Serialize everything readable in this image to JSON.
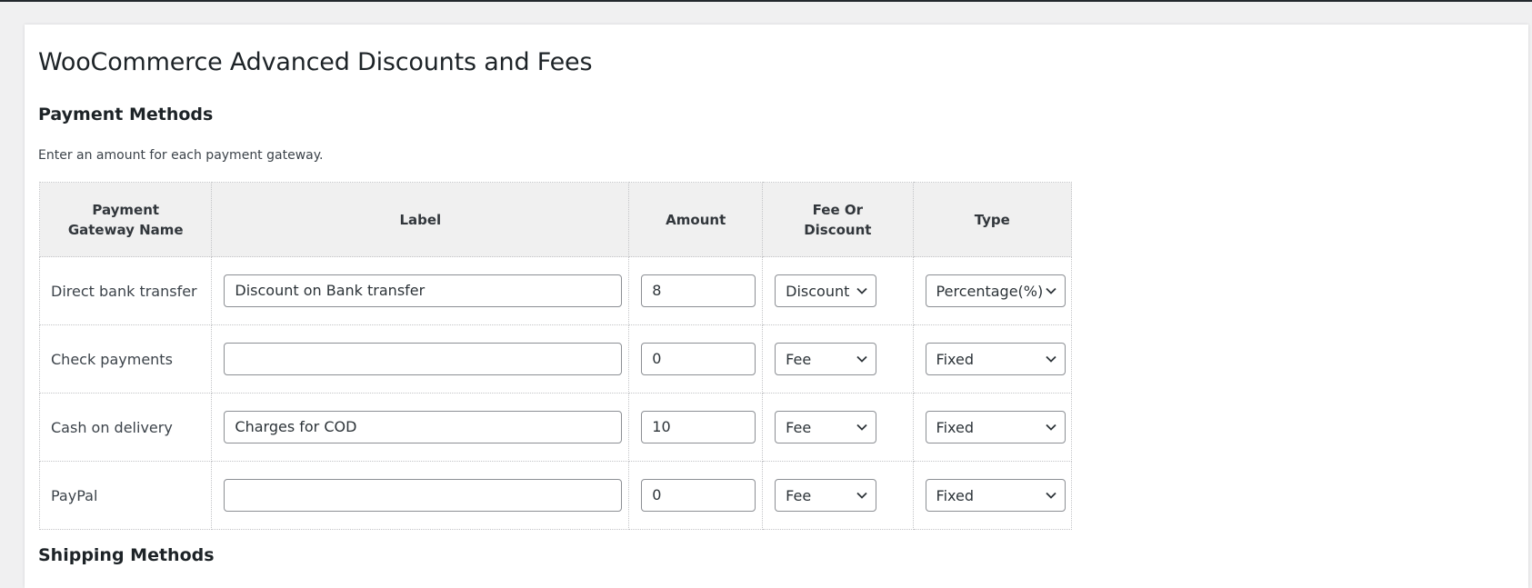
{
  "page": {
    "title": "WooCommerce Advanced Discounts and Fees"
  },
  "payment_section": {
    "title": "Payment Methods",
    "description": "Enter an amount for each payment gateway.",
    "columns": [
      "Payment Gateway Name",
      "Label",
      "Amount",
      "Fee Or Discount",
      "Type"
    ],
    "rows": [
      {
        "gateway": "Direct bank transfer",
        "label": "Discount on Bank transfer",
        "amount": "8",
        "fee_or_discount": "Discount",
        "type": "Percentage(%)"
      },
      {
        "gateway": "Check payments",
        "label": "",
        "amount": "0",
        "fee_or_discount": "Fee",
        "type": "Fixed"
      },
      {
        "gateway": "Cash on delivery",
        "label": "Charges for COD",
        "amount": "10",
        "fee_or_discount": "Fee",
        "type": "Fixed"
      },
      {
        "gateway": "PayPal",
        "label": "",
        "amount": "0",
        "fee_or_discount": "Fee",
        "type": "Fixed"
      }
    ]
  },
  "shipping_section": {
    "title": "Shipping Methods"
  },
  "icons": {
    "select_arrow": "chevron-down-icon"
  }
}
